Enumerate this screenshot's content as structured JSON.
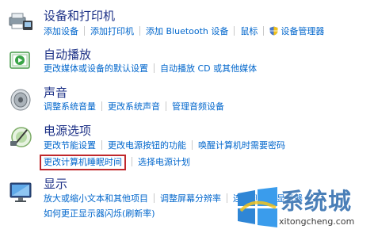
{
  "sections": [
    {
      "title": "设备和打印机",
      "links": [
        "添加设备",
        "添加打印机",
        "添加 Bluetooth 设备",
        "鼠标",
        "设备管理器"
      ],
      "icon": "printer-icon"
    },
    {
      "title": "自动播放",
      "links": [
        "更改媒体或设备的默认设置",
        "自动播放 CD 或其他媒体"
      ],
      "icon": "autoplay-icon"
    },
    {
      "title": "声音",
      "links": [
        "调整系统音量",
        "更改系统声音",
        "管理音频设备"
      ],
      "icon": "speaker-icon"
    },
    {
      "title": "电源选项",
      "links": [
        "更改节能设置",
        "更改电源按钮的功能",
        "唤醒计算机时需要密码"
      ],
      "links2": [
        "更改计算机睡眠时间",
        "选择电源计划"
      ],
      "icon": "power-icon"
    },
    {
      "title": "显示",
      "links": [
        "放大或缩小文本和其他项目",
        "调整屏幕分辨率",
        "连接到外部显示器"
      ],
      "links2": [
        "如何更正显示器闪烁(刷新率)"
      ],
      "icon": "display-icon"
    }
  ],
  "watermark": {
    "logo_text": "系统城",
    "url": "xitongcheng.com"
  },
  "colors": {
    "title": "#1e3287",
    "link": "#0066cc",
    "highlight": "#c0282c"
  }
}
